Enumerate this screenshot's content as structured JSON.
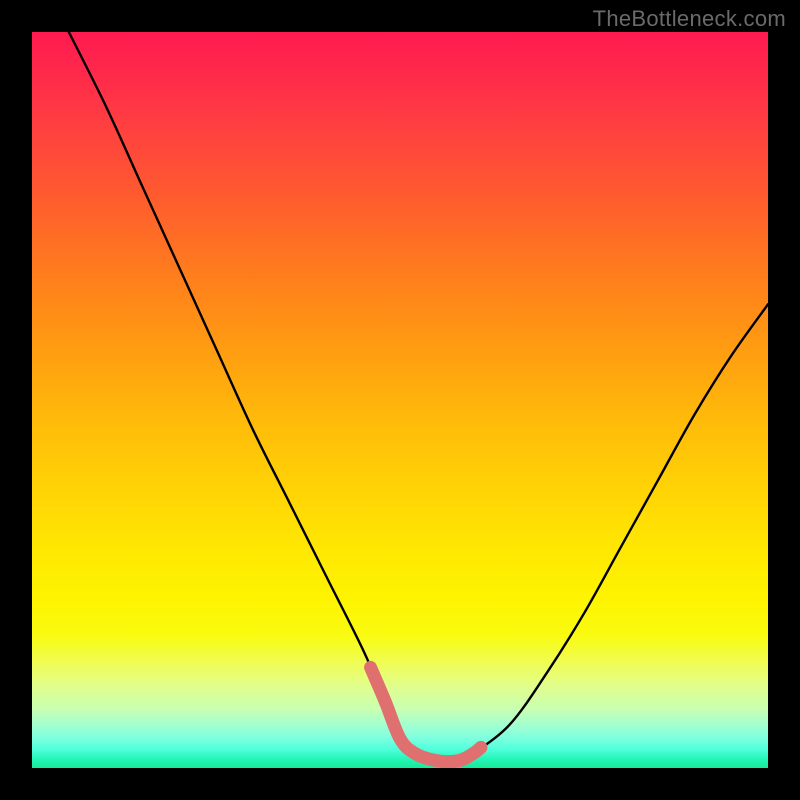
{
  "watermark": "TheBottleneck.com",
  "colors": {
    "page_bg": "#000000",
    "watermark": "#6a6a6a",
    "curve": "#000000",
    "accent_segment": "#e07070"
  },
  "chart_data": {
    "type": "line",
    "title": "",
    "xlabel": "",
    "ylabel": "",
    "xlim": [
      0,
      100
    ],
    "ylim": [
      0,
      100
    ],
    "grid": false,
    "legend": false,
    "series": [
      {
        "name": "primary-curve",
        "x": [
          5,
          10,
          15,
          20,
          25,
          30,
          35,
          40,
          45,
          48,
          50,
          52,
          55,
          58,
          60,
          65,
          70,
          75,
          80,
          85,
          90,
          95,
          100
        ],
        "y": [
          100,
          90,
          79,
          68,
          57,
          46,
          36,
          26,
          16,
          9,
          4,
          2,
          1,
          1,
          2,
          6,
          13,
          21,
          30,
          39,
          48,
          56,
          63
        ]
      }
    ],
    "annotations": [
      {
        "name": "accent-segment",
        "kind": "highlight-span",
        "x_start": 46,
        "x_end": 61,
        "note": "thick pink segment near minimum"
      }
    ],
    "background_gradient_stops": [
      {
        "pos": 0.0,
        "color": "#ff1a50"
      },
      {
        "pos": 0.13,
        "color": "#ff4040"
      },
      {
        "pos": 0.32,
        "color": "#ff7a1e"
      },
      {
        "pos": 0.52,
        "color": "#ffb80a"
      },
      {
        "pos": 0.7,
        "color": "#ffe702"
      },
      {
        "pos": 0.82,
        "color": "#f9fb10"
      },
      {
        "pos": 0.92,
        "color": "#c8ffb2"
      },
      {
        "pos": 1.0,
        "color": "#16e999"
      }
    ]
  }
}
